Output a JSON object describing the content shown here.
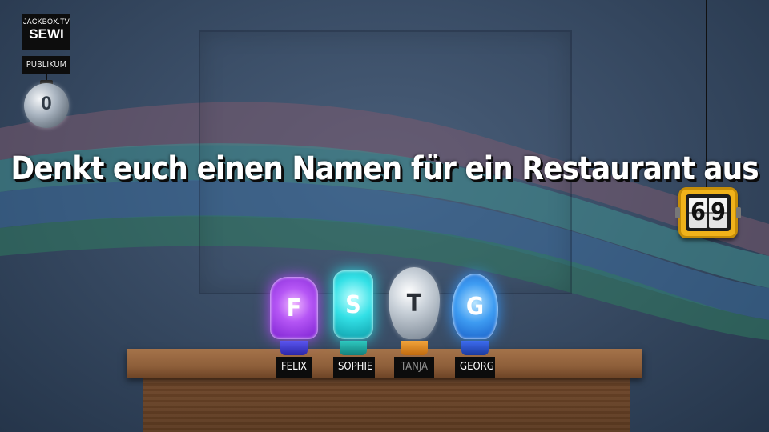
{
  "branding": {
    "site": "JACKBOX.TV",
    "room_code": "SEWI"
  },
  "audience": {
    "label": "PUBLIKUM",
    "count": "0"
  },
  "prompt": {
    "text": "Denkt euch einen Namen für ein Restaurant aus"
  },
  "timer": {
    "digit_1": "6",
    "digit_2": "9",
    "color": "#f0b21a"
  },
  "players": [
    {
      "initial": "F",
      "name": "FELIX",
      "color": "#a63df0",
      "base_color": "#3b35d1",
      "active": true
    },
    {
      "initial": "S",
      "name": "SOPHIE",
      "color": "#26d4d9",
      "base_color": "#1aa6a0",
      "active": true
    },
    {
      "initial": "T",
      "name": "TANJA",
      "color": "#c5ced6",
      "base_color": "#e5881b",
      "active": false
    },
    {
      "initial": "G",
      "name": "GEORG",
      "color": "#2e8cf0",
      "base_color": "#1f4fc8",
      "active": true
    }
  ]
}
